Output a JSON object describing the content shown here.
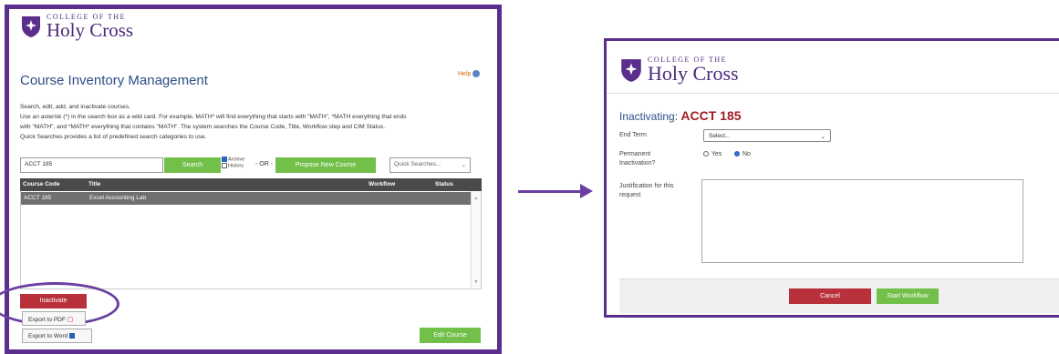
{
  "brand": {
    "top": "COLLEGE OF THE",
    "main": "Holy Cross",
    "color": "#5b2d8c"
  },
  "left": {
    "title": "Course Inventory Management",
    "help": "Help",
    "desc": [
      "Search, edit, add, and inactivate courses.",
      "Use an asterisk (*) in the search box as a wild card. For example, MATH* will find everything that starts with \"MATH\", *MATH everything that ends",
      "with \"MATH\", and *MATH* everything that contains \"MATH\". The system searches the Course Code, Title, Workflow step and CIM Status.",
      "Quick Searches provides a list of predefined search categories to use."
    ],
    "search_value": "ACCT 185",
    "search_button": "Search",
    "archive_label": "Archive",
    "history_label": "History",
    "or_label": "- OR -",
    "propose_button": "Propose New Course",
    "quick_searches": "Quick Searches...",
    "columns": [
      "Course Code",
      "Title",
      "Workflow",
      "Status"
    ],
    "rows": [
      {
        "code": "ACCT 185",
        "title": "Excel Accounting Lab",
        "workflow": "",
        "status": ""
      }
    ],
    "inactivate_button": "Inactivate",
    "export_pdf": "Export to PDF",
    "export_word": "Export to Word",
    "edit_button": "Edit Course"
  },
  "right": {
    "heading_prefix": "Inactivating:",
    "course": "ACCT 185",
    "end_term_label": "End Term",
    "end_term_value": "Select...",
    "permanent_label_1": "Permanent",
    "permanent_label_2": "Inactivation?",
    "yes_label": "Yes",
    "no_label": "No",
    "no_selected": true,
    "justification_label_1": "Justification for this",
    "justification_label_2": "request",
    "cancel_button": "Cancel",
    "start_button": "Start Workflow"
  },
  "colors": {
    "accent": "#6a3fa1",
    "green": "#72c04a",
    "red": "#b8313a",
    "title_blue": "#2c4f86"
  }
}
